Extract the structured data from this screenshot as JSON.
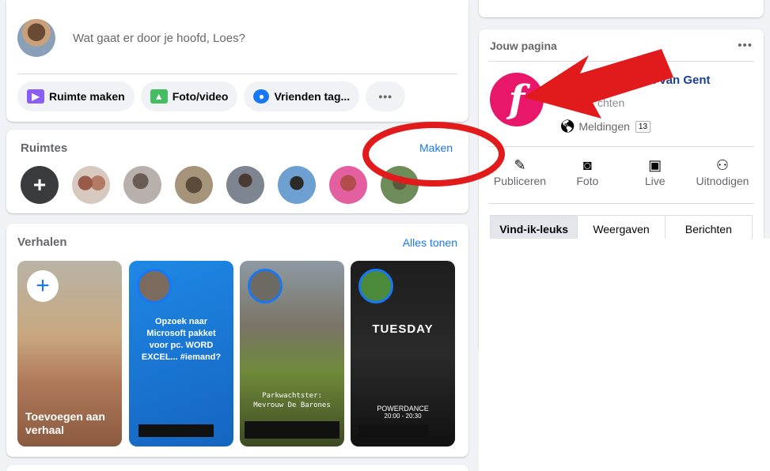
{
  "composer": {
    "placeholder": "Wat gaat er door je hoofd, Loes?",
    "actions": [
      {
        "label": "Ruimte maken",
        "icon": "video-room-icon"
      },
      {
        "label": "Foto/video",
        "icon": "photo-icon"
      },
      {
        "label": "Vrienden tag...",
        "icon": "tag-friends-icon"
      }
    ],
    "more": "•••"
  },
  "rooms": {
    "title": "Ruimtes",
    "make_link": "Maken",
    "add_symbol": "+"
  },
  "stories": {
    "title": "Verhalen",
    "show_all": "Alles tonen",
    "add_label": "Toevoegen aan verhaal",
    "add_symbol": "+",
    "story2_text": "Opzoek naar Microsoft pakket voor pc. WORD EXCEL... #iemand?",
    "story3_text": "Parkwachtster: Mevrouw De Barones",
    "story4_title": "TUESDAY",
    "story4_sub": "POWERDANCE",
    "story4_time": "20:00 - 20:30"
  },
  "page_card": {
    "title": "Jouw pagina",
    "more": "•••",
    "name": "n van Gent",
    "messages": "chten",
    "notifications": "Meldingen",
    "notification_count": "13",
    "logo_letter": "f",
    "actions": [
      {
        "label": "Publiceren",
        "icon": "edit-icon"
      },
      {
        "label": "Foto",
        "icon": "camera-icon"
      },
      {
        "label": "Live",
        "icon": "live-video-icon"
      },
      {
        "label": "Uitnodigen",
        "icon": "invite-icon"
      }
    ],
    "tabs": [
      "Vind-ik-leuks",
      "Weergaven",
      "Berichten"
    ]
  },
  "colors": {
    "accent": "#1877f2",
    "annotation": "#e11b1b",
    "brand_pink": "#e9176a"
  }
}
